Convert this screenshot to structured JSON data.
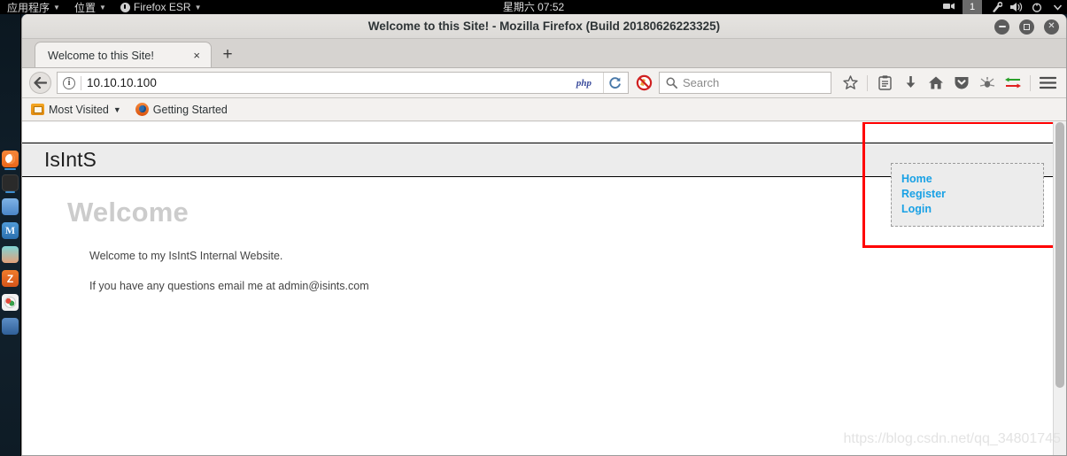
{
  "desktop": {
    "panel": {
      "applications_label": "应用程序",
      "places_label": "位置",
      "app_label": "Firefox ESR",
      "clock": "星期六 07:52",
      "workspace": "1",
      "tray": [
        "display-icon",
        "workspace-indicator",
        "network-icon",
        "volume-icon",
        "power-icon",
        "chevron-down-icon"
      ]
    },
    "dock": [
      {
        "name": "firefox",
        "label": "Firefox ESR"
      },
      {
        "name": "terminal",
        "label": "Terminal"
      },
      {
        "name": "files",
        "label": "Files"
      },
      {
        "name": "metasploit",
        "label": "M"
      },
      {
        "name": "armitage",
        "label": "Armitage"
      },
      {
        "name": "zenmap",
        "label": "Z"
      },
      {
        "name": "palette",
        "label": "Burp Suite"
      },
      {
        "name": "blue-app",
        "label": "App"
      }
    ]
  },
  "window": {
    "title": "Welcome to this Site! - Mozilla Firefox (Build 20180626223325)",
    "minimize_label": "Minimize",
    "maximize_label": "Maximize",
    "close_label": "Close"
  },
  "tabs": [
    {
      "label": "Welcome to this Site!",
      "close": "×"
    }
  ],
  "newtab_label": "+",
  "navbar": {
    "back_label": "Back",
    "url": "10.10.10.100",
    "php_badge": "php",
    "reload_label": "Reload",
    "noscript_label": "NoScript",
    "search_placeholder": "Search",
    "icons": [
      "star-icon",
      "library-icon",
      "downloads-icon",
      "home-icon",
      "pocket-icon",
      "hackbar-icon",
      "proxy-arrows-icon",
      "hamburger-menu-icon"
    ]
  },
  "bookmarks": [
    {
      "label": "Most Visited",
      "icon": "most-visited-folder-icon",
      "caret": "⌄"
    },
    {
      "label": "Getting Started",
      "icon": "firefox-icon",
      "caret": ""
    }
  ],
  "page": {
    "site_title": "IsIntS",
    "heading": "Welcome",
    "paragraphs": [
      "Welcome to my IsIntS Internal Website.",
      "If you have any questions email me at admin@isints.com"
    ],
    "nav_links": [
      {
        "label": "Home"
      },
      {
        "label": "Register"
      },
      {
        "label": "Login"
      }
    ]
  },
  "annotation": {
    "color": "#ff0000"
  },
  "watermark": "https://blog.csdn.net/qq_34801745"
}
